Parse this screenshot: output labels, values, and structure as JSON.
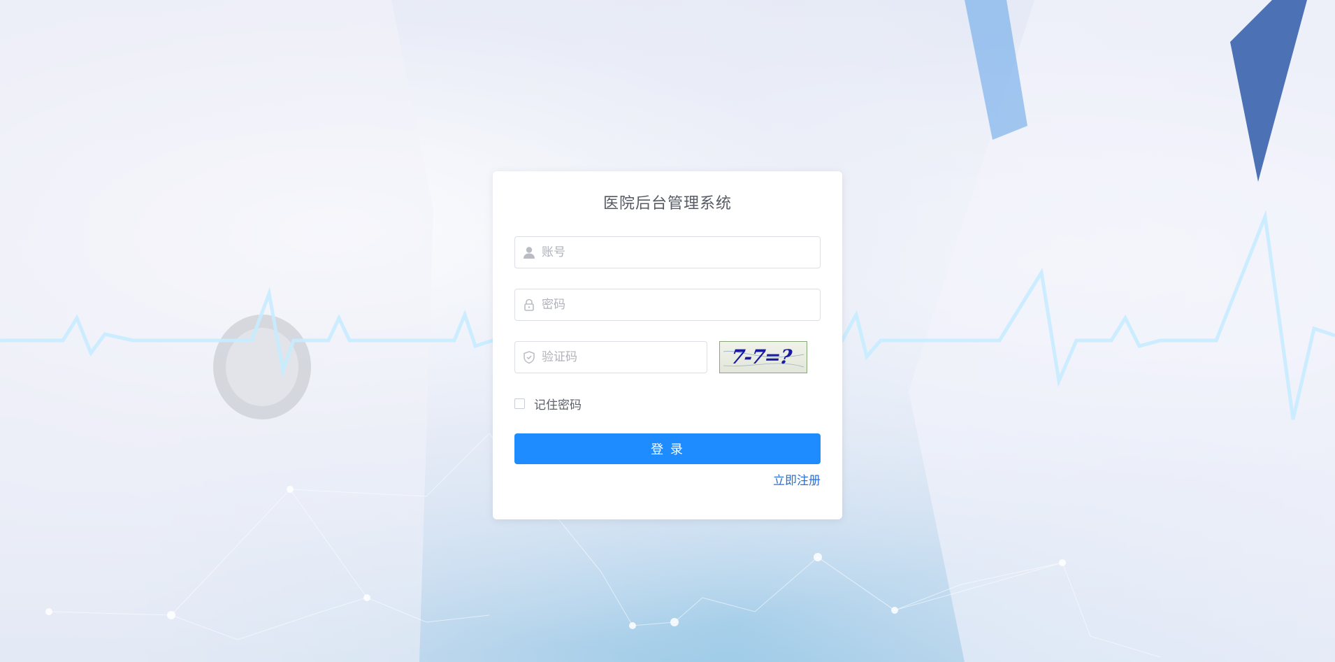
{
  "login": {
    "title": "医院后台管理系统",
    "username": {
      "placeholder": "账号",
      "value": ""
    },
    "password": {
      "placeholder": "密码",
      "value": ""
    },
    "captcha": {
      "placeholder": "验证码",
      "value": "",
      "image_text": "7-7=?"
    },
    "remember_label": "记住密码",
    "remember_checked": false,
    "submit_label": "登 录",
    "register_label": "立即注册"
  },
  "colors": {
    "primary": "#1e8bff",
    "link": "#2d6fd1",
    "title": "#555a63",
    "border": "#dcdfe6",
    "captcha_text": "#1a1aa0"
  },
  "icons": [
    "user-icon",
    "lock-icon",
    "shield-icon"
  ]
}
